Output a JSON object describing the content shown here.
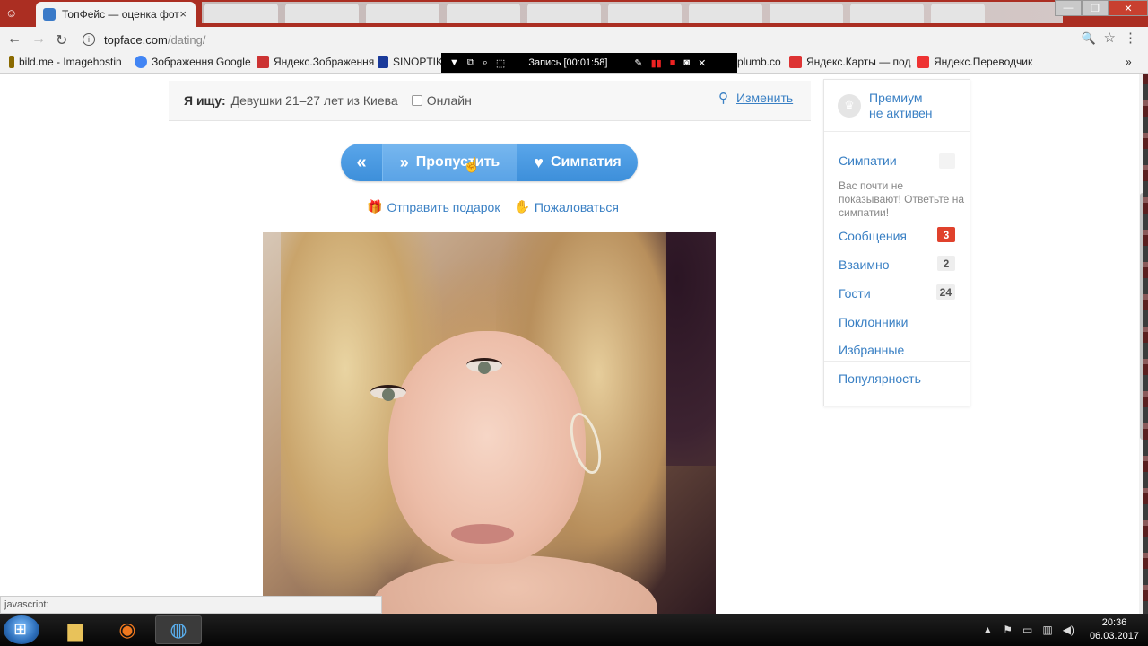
{
  "browser": {
    "tab_title": "ТопФейс — оценка фот",
    "tab_close": "×",
    "url_host": "topface.com",
    "url_path": "/dating/",
    "window_controls": [
      "—",
      "❐",
      "✕"
    ]
  },
  "bookmarks": [
    {
      "label": "bild.me - Imagehostin",
      "icon_color": "#8a6a00"
    },
    {
      "label": "Зображення Google",
      "icon_color": "#4285f4"
    },
    {
      "label": "Яндекс.Зображення",
      "icon_color": "#c33"
    },
    {
      "label": "SINOPTIK",
      "icon_color": "#1a3a9a"
    },
    {
      "label": "plumb.co",
      "icon_color": "#888"
    },
    {
      "label": "Яндекс.Карты — под",
      "icon_color": "#d33"
    },
    {
      "label": "Яндекс.Переводчик",
      "icon_color": "#e33"
    }
  ],
  "recorder": {
    "label": "Запись [00:01:58]"
  },
  "search": {
    "label": "Я ищу:",
    "value": "Девушки  21–27 лет из Киева",
    "online_label": "Онлайн",
    "change_label": "Изменить"
  },
  "actions": {
    "back_label": "«",
    "skip_label": "Пропустить",
    "like_label": "Симпатия",
    "gift_label": "Отправить подарок",
    "complain_label": "Пожаловаться"
  },
  "sidebar": {
    "premium_text": "Премиум не активен",
    "premium_line1": "Премиум",
    "premium_line2": "не активен",
    "likes_label": "Симпатии",
    "likes_note": "Вас почти не показывают! Ответьте на симпатии!",
    "messages_label": "Сообщения",
    "messages_count": "3",
    "mutual_label": "Взаимно",
    "mutual_count": "2",
    "guests_label": "Гости",
    "guests_count": "24",
    "fans_label": "Поклонники",
    "favorites_label": "Избранные",
    "popularity_label": "Популярность"
  },
  "status_bar": "javascript:",
  "taskbar": {
    "time": "20:36",
    "date": "06.03.2017"
  },
  "colors": {
    "link": "#3a80c4",
    "button": "#3d8fda",
    "badge_red": "#e0412c",
    "badge_gray": "#e8e8e8"
  }
}
